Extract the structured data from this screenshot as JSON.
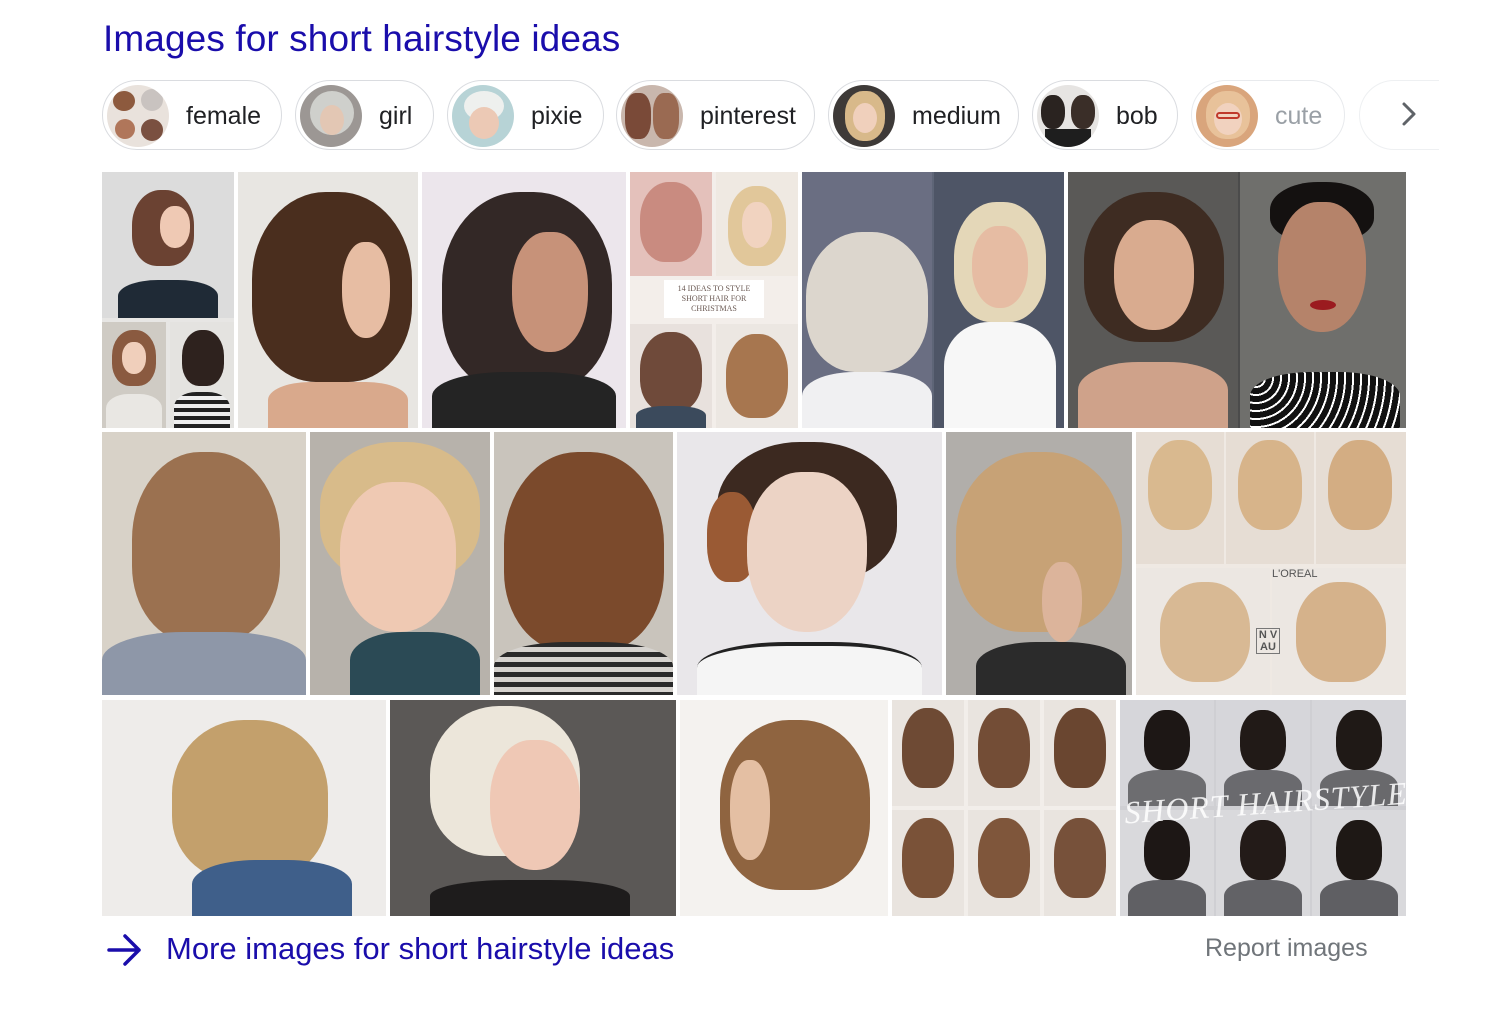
{
  "title": "Images for short hairstyle ideas",
  "chips": [
    {
      "label": "female"
    },
    {
      "label": "girl"
    },
    {
      "label": "pixie"
    },
    {
      "label": "pinterest"
    },
    {
      "label": "medium"
    },
    {
      "label": "bob"
    },
    {
      "label": "cute"
    }
  ],
  "next_icon": "chevron-right-icon",
  "tile_texts": {
    "christmas": "14 IDEAS TO STYLE SHORT HAIR FOR CHRISTMAS",
    "loreal": "L'OREAL",
    "nvau": "N V AU",
    "short_hairstyles": "SHORT HAIRSTYLES"
  },
  "footer": {
    "more_label": "More images for short hairstyle ideas",
    "more_icon": "arrow-right-icon",
    "report_label": "Report images"
  },
  "colors": {
    "link": "#1a0dab",
    "chip_border": "#dadce0",
    "muted": "#70757a"
  }
}
